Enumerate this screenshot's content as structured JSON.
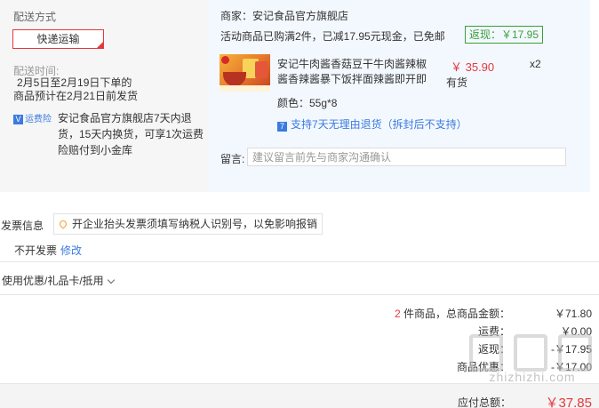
{
  "shipping": {
    "method_label": "配送方式",
    "method_value": "快递运输",
    "time_label": "配送时间:",
    "time_value_1": "2月5日至2月19日下单的",
    "time_value_2": "商品预计在2月21日前发货",
    "insurance_badge": "运费险",
    "insurance_text": "安记食品官方旗舰店7天内退货，15天内换货，可享1次运费险赔付到小金库"
  },
  "order": {
    "seller": "商家：安记食品官方旗舰店",
    "promo": "活动商品已购满2件，已减17.95元现金，已免邮",
    "rebate": "返现：￥17.95",
    "product": {
      "title": "安记牛肉酱香菇豆干牛肉酱辣椒酱香辣酱暴下饭拌面辣酱即开即",
      "price": "￥ 35.90",
      "qty": "x2",
      "stock": "有货",
      "spec": "颜色：55g*8",
      "return_policy": "支持7天无理由退货（拆封后不支持）"
    },
    "message_label": "留言:",
    "message_placeholder": "建议留言前先与商家沟通确认"
  },
  "invoice": {
    "label": "发票信息",
    "tip": "开企业抬头发票须填写纳税人识别号，以免影响报销",
    "value": "不开发票",
    "edit": "修改"
  },
  "coupon_label": "使用优惠/礼品卡/抵用",
  "summary": {
    "count_num": "2",
    "count_text": " 件商品，总商品金额：",
    "goods_total": "￥71.80",
    "shipping_label": "运费：",
    "shipping_value": "￥0.00",
    "rebate_label": "返现：",
    "rebate_value": "-￥17.95",
    "discount_label": "商品优惠：",
    "discount_value": "-￥17.00",
    "payable_label": "应付总额：",
    "payable_value": "￥37.85"
  },
  "watermark": "zhizhizhi.com",
  "colors": {
    "accent_red": "#e4393c",
    "link_blue": "#3b7be0",
    "green": "#3aa03a"
  }
}
